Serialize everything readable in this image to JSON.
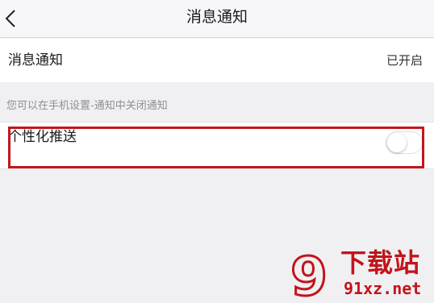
{
  "nav": {
    "title": "消息通知",
    "back_icon": "chevron-left-icon"
  },
  "settings": {
    "notify_label": "消息通知",
    "notify_status": "已开启",
    "hint": "您可以在手机设置-通知中关闭通知",
    "push_label": "个性化推送",
    "push_enabled": false
  },
  "watermark": {
    "logo": "9",
    "title": "下载站",
    "url": "91xz.net"
  },
  "colors": {
    "highlight": "#c4161c",
    "watermark": "#c2141b"
  }
}
